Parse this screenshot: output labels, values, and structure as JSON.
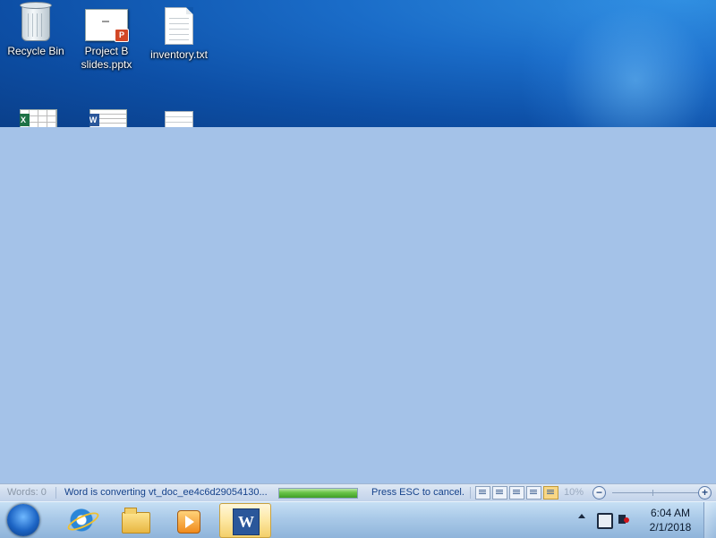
{
  "desktop": {
    "icons": [
      {
        "label": "Recycle Bin",
        "icon": "recycle-bin-icon"
      },
      {
        "label": "Project B slides.pptx",
        "icon": "powerpoint-file-icon"
      },
      {
        "label": "inventory.txt",
        "icon": "text-file-icon"
      }
    ],
    "partial_icons": [
      "excel-file-icon",
      "word-file-icon",
      "text-file-icon"
    ]
  },
  "word_status": {
    "words": "Words: 0",
    "message": "Word is converting vt_doc_ee4c6d29054130...",
    "progress": 1.0,
    "esc_hint": "Press ESC to cancel.",
    "view_buttons": [
      "print-layout",
      "full-screen-reading",
      "web-layout",
      "outline",
      "draft"
    ],
    "active_view": "draft",
    "zoom": "10%",
    "zoom_out": "−",
    "zoom_in": "+"
  },
  "taskbar": {
    "apps": [
      {
        "name": "internet-explorer",
        "active": false
      },
      {
        "name": "windows-explorer",
        "active": false
      },
      {
        "name": "windows-media-player",
        "active": false
      },
      {
        "name": "microsoft-word",
        "active": true,
        "glyph": "W"
      }
    ],
    "clock": {
      "time": "6:04 AM",
      "date": "2/1/2018"
    }
  },
  "colors": {
    "desktop_blue": "#0d4fa6",
    "word_background": "#a4c2e8",
    "progress_green": "#3e9e26",
    "accent_text": "#15428b"
  }
}
